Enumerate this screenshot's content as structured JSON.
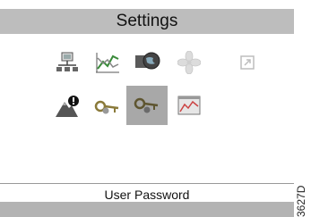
{
  "header": {
    "title": "Settings"
  },
  "icons": [
    {
      "name": "network-icon",
      "selected": false
    },
    {
      "name": "trend-chart-icon",
      "selected": false
    },
    {
      "name": "globe-display-icon",
      "selected": false
    },
    {
      "name": "fan-icon",
      "selected": false
    },
    {
      "name": "external-link-icon",
      "selected": false
    },
    {
      "name": "alarm-mountain-icon",
      "selected": false
    },
    {
      "name": "service-key-icon",
      "selected": false
    },
    {
      "name": "user-key-icon",
      "selected": true
    },
    {
      "name": "graph-window-icon",
      "selected": false
    }
  ],
  "status": {
    "label": "User Password"
  },
  "figure_code": "3627D"
}
